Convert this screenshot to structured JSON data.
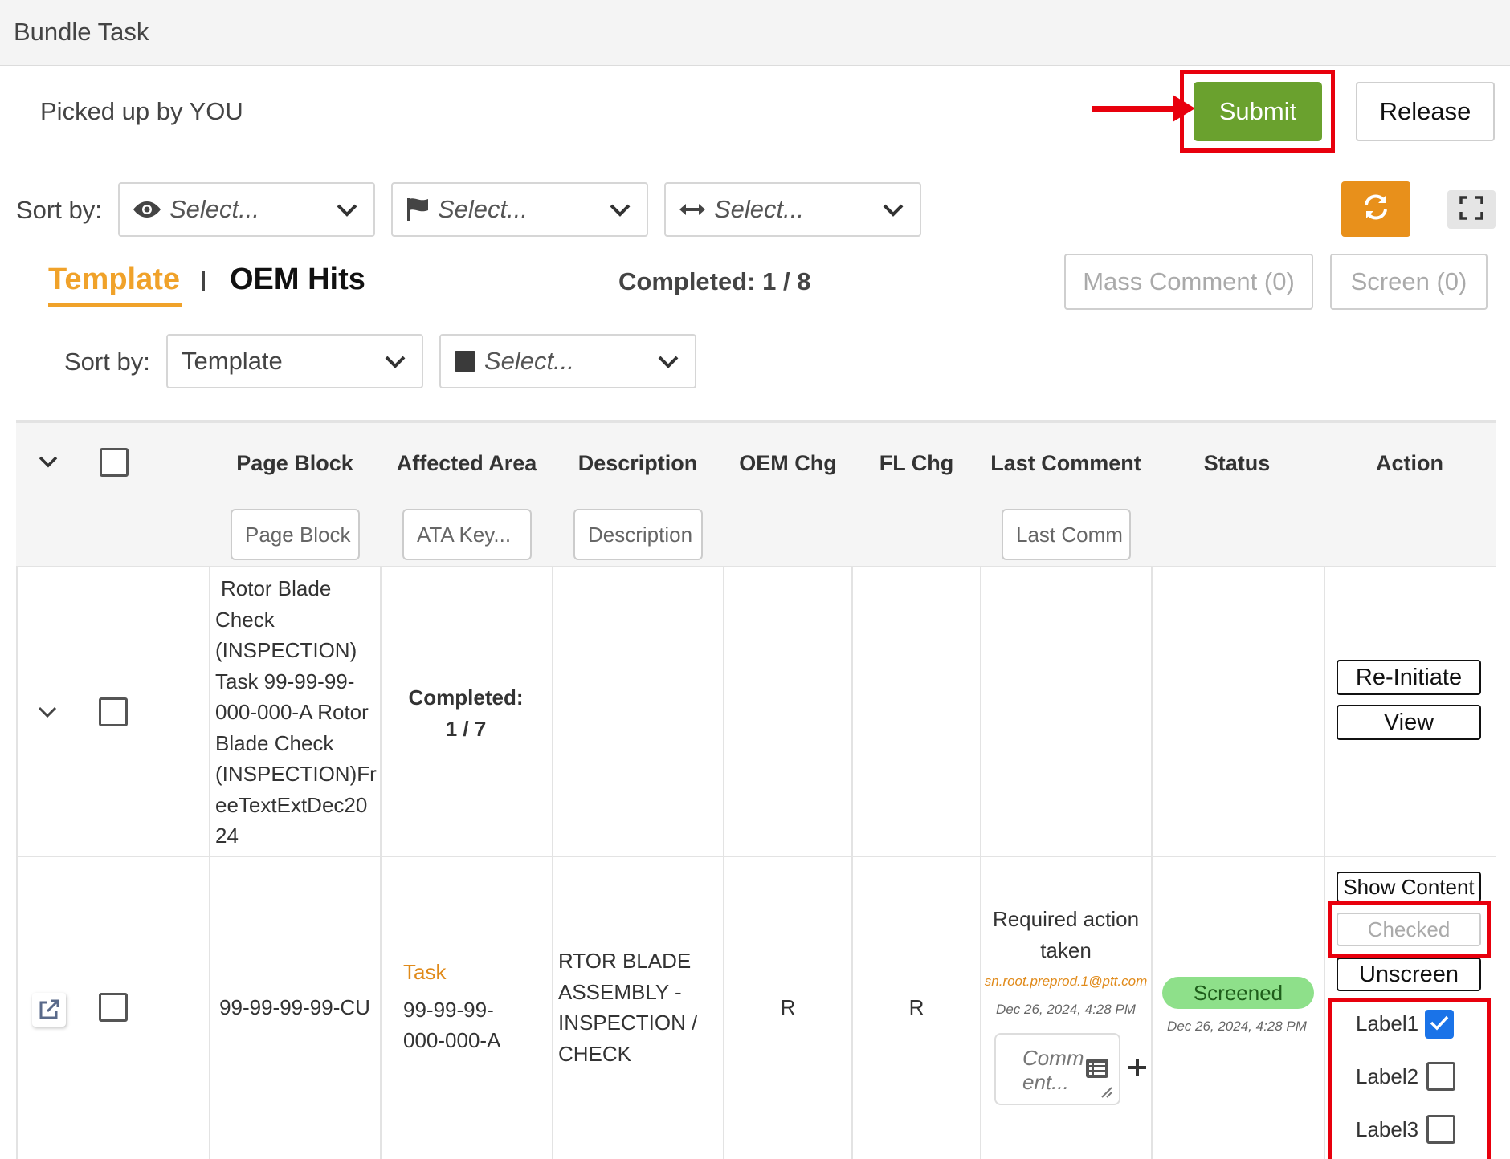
{
  "header": {
    "title": "Bundle Task"
  },
  "status_text": "Picked up by YOU",
  "actions": {
    "submit_label": "Submit",
    "release_label": "Release"
  },
  "sort_bar": {
    "label": "Sort by:",
    "selects": [
      {
        "icon": "eye-icon",
        "placeholder": "Select..."
      },
      {
        "icon": "flag-icon",
        "placeholder": "Select..."
      },
      {
        "icon": "left-right-arrow-icon",
        "placeholder": "Select..."
      }
    ]
  },
  "tabs": [
    {
      "label": "Template",
      "active": true
    },
    {
      "label": "OEM Hits",
      "active": false
    }
  ],
  "completed": {
    "label": "Completed:",
    "value": "1 / 8"
  },
  "buttons": {
    "mass_comment": "Mass Comment (0)",
    "screen": "Screen (0)"
  },
  "sort_bar_2": {
    "label": "Sort by:",
    "template_value": "Template",
    "second_placeholder": "Select..."
  },
  "table": {
    "columns": [
      "Page Block",
      "Affected Area",
      "Description",
      "OEM Chg",
      "FL Chg",
      "Last Comment",
      "Status",
      "Action"
    ],
    "filters": {
      "page_block": "Page Block",
      "ata_key": "ATA Key...",
      "description": "Description",
      "last_comment": "Last Comm"
    },
    "rows": [
      {
        "page_block_lines": [
          "Rotor Blade",
          "Check",
          "(INSPECTION)",
          "Task 99-99-99-",
          "000-000-A Rotor",
          "Blade Check",
          "(INSPECTION)Fr",
          "eeTextExtDec20",
          "24"
        ],
        "affected_area_label": "Completed:",
        "affected_area_value": "1 / 7",
        "actions": [
          "Re-Initiate",
          "View"
        ]
      },
      {
        "page_block": "99-99-99-99-CU",
        "affected_area_type": "Task",
        "affected_area_lines": [
          "99-99-99-",
          "000-000-A"
        ],
        "description_lines": [
          "RTOR BLADE",
          "ASSEMBLY -",
          "INSPECTION /",
          "CHECK"
        ],
        "oem_chg": "R",
        "fl_chg": "R",
        "last_comment_lines": [
          "Required action",
          "taken"
        ],
        "last_comment_email": "sn.root.preprod.1@ptt.com",
        "last_comment_time": "Dec 26, 2024, 4:28 PM",
        "comment_placeholder": "Comment...",
        "status_badge": "Screened",
        "status_time": "Dec 26, 2024, 4:28 PM",
        "actions": [
          "Show Content",
          "Checked",
          "Unscreen"
        ],
        "labels": [
          {
            "name": "Label1",
            "checked": true
          },
          {
            "name": "Label2",
            "checked": false
          },
          {
            "name": "Label3",
            "checked": false
          }
        ]
      }
    ]
  },
  "colors": {
    "submit": "#6aa12e",
    "accent_orange": "#e8901b",
    "tab_active": "#f0a22a",
    "highlight_red": "#e8000d",
    "screened_badge": "#8ee08a",
    "checkbox_checked": "#1a73e8"
  }
}
